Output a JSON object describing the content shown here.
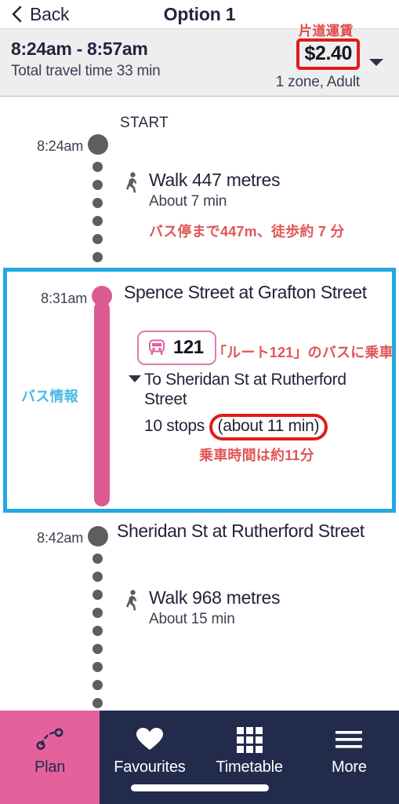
{
  "header": {
    "back_label": "Back",
    "title": "Option 1"
  },
  "summary": {
    "times": "8:24am - 8:57am",
    "total_travel": "Total travel time 33 min",
    "fare": "$2.40",
    "fare_detail": "1 zone, Adult",
    "jp_fare_note": "片道運賃"
  },
  "itinerary": {
    "start_label": "START",
    "segments": {
      "origin": {
        "time": "8:24am",
        "walk_title": "Walk 447 metres",
        "walk_sub": "About 7 min",
        "jp_note": "バス停まで447m、徒歩約 7 分"
      },
      "board": {
        "time": "8:31am",
        "stop_name": "Spence Street at Grafton Street",
        "route_number": "121",
        "jp_route_note": "「ルート121」のバスに乗車",
        "destination": "To Sheridan St at Rutherford Street",
        "stops_prefix": "10 stops ",
        "stops_duration": "(about 11 min)",
        "jp_ride_note": "乗車時間は約11分",
        "jp_side_label": "バス情報"
      },
      "alight": {
        "time": "8:42am",
        "stop_name": "Sheridan St at Rutherford Street",
        "walk_title": "Walk 968 metres",
        "walk_sub": "About 15 min"
      }
    }
  },
  "nav": {
    "items": [
      {
        "label": "Plan",
        "icon": "route-plan-icon",
        "active": true
      },
      {
        "label": "Favourites",
        "icon": "heart-icon",
        "active": false
      },
      {
        "label": "Timetable",
        "icon": "grid-icon",
        "active": false
      },
      {
        "label": "More",
        "icon": "hamburger-icon",
        "active": false
      }
    ]
  },
  "colors": {
    "brand_pink": "#dd5b95",
    "nav_navy": "#232b4d",
    "highlight_blue": "#24a9e0",
    "annotation_red": "#e01b1b",
    "annotation_red_text": "#e15656"
  }
}
